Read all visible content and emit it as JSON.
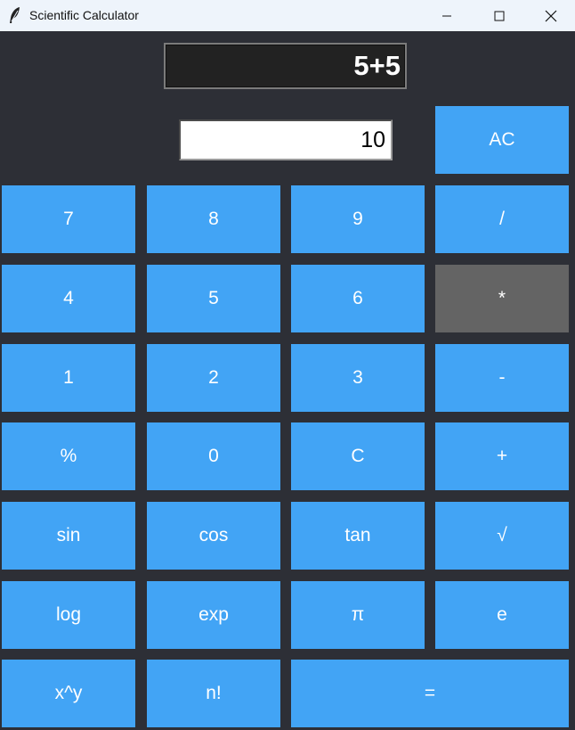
{
  "window": {
    "title": "Scientific Calculator",
    "app_icon": "feather-icon"
  },
  "display": {
    "expression": "5+5",
    "result": "10"
  },
  "buttons": {
    "ac": "AC",
    "seven": "7",
    "eight": "8",
    "nine": "9",
    "divide": "/",
    "four": "4",
    "five": "5",
    "six": "6",
    "multiply": "*",
    "one": "1",
    "two": "2",
    "three": "3",
    "subtract": "-",
    "percent": "%",
    "zero": "0",
    "clear": "C",
    "add": "+",
    "sin": "sin",
    "cos": "cos",
    "tan": "tan",
    "sqrt": "√",
    "log": "log",
    "exp": "exp",
    "pi": "π",
    "e": "e",
    "power": "x^y",
    "factorial": "n!",
    "equals": "="
  },
  "colors": {
    "button": "#42a4f5",
    "active_button": "#646464",
    "background": "#2d2f36",
    "display": "#222222",
    "titlebar": "#eef4fb"
  }
}
